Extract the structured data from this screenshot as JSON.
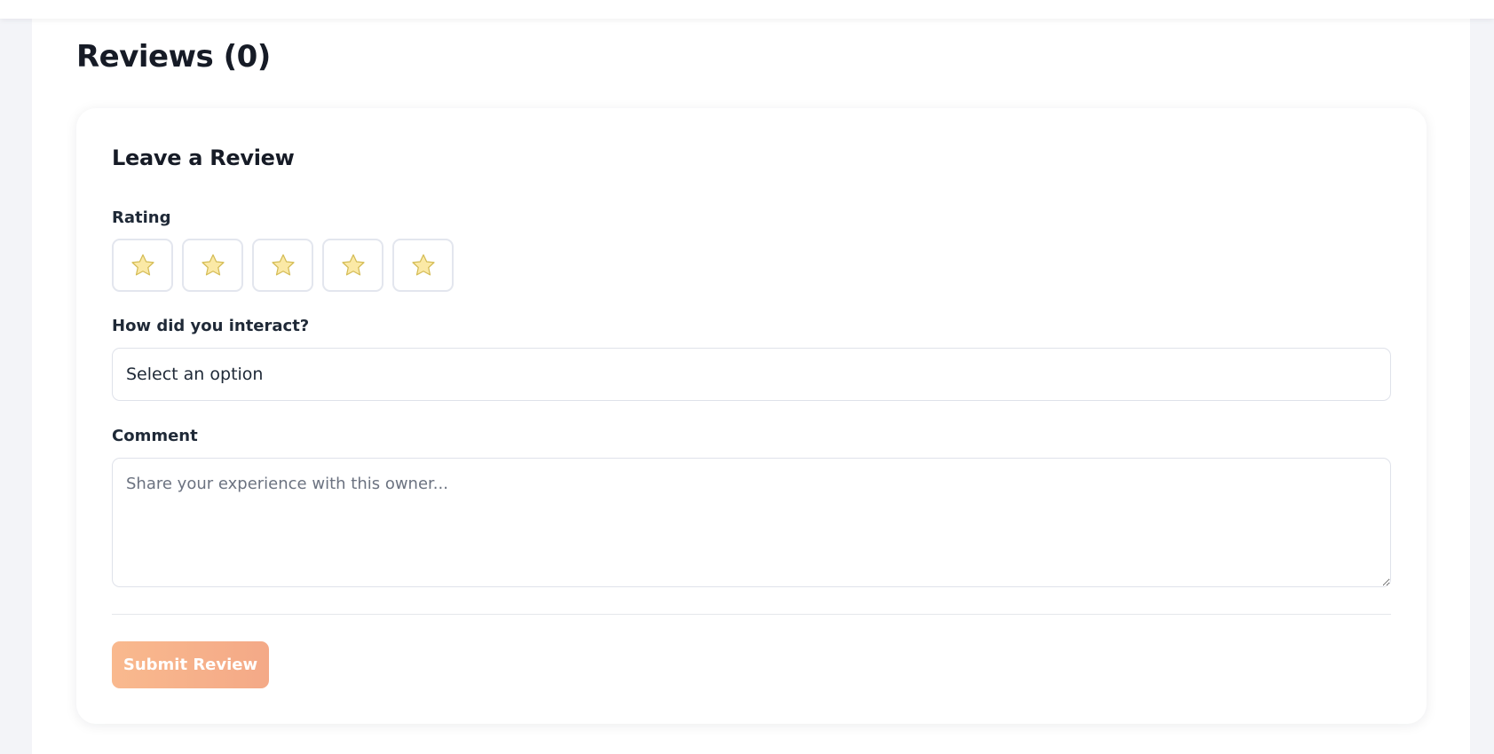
{
  "reviews": {
    "title": "Reviews (0)"
  },
  "form": {
    "title": "Leave a Review",
    "rating": {
      "label": "Rating",
      "max_stars": 5,
      "selected": 0,
      "star_color": "#fbe9a6",
      "star_outline": "#d4bc55"
    },
    "interaction": {
      "label": "How did you interact?",
      "selected_value": "Select an option"
    },
    "comment": {
      "label": "Comment",
      "placeholder": "Share your experience with this owner..."
    },
    "submit": {
      "label": "Submit Review",
      "color": "#f9b98e"
    }
  }
}
